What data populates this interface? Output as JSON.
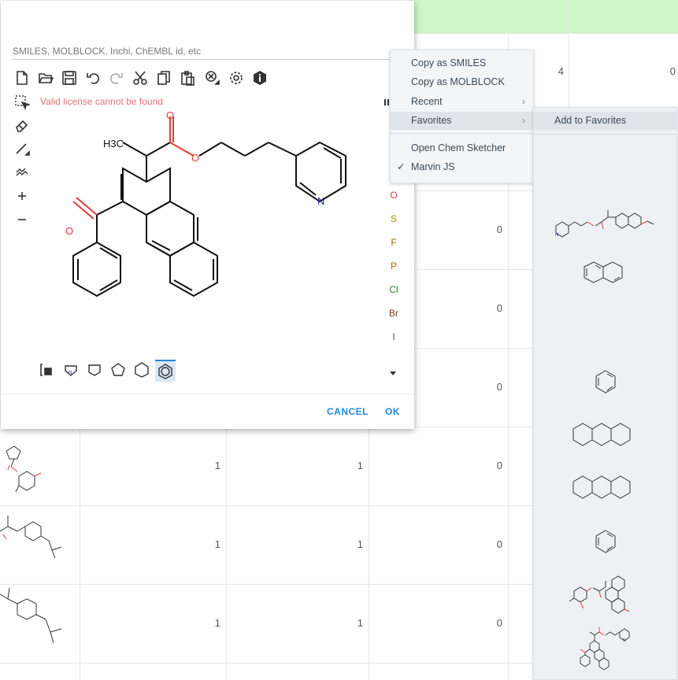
{
  "editor": {
    "input_placeholder": "SMILES, MOLBLOCK, Inchi, ChEMBL id, etc",
    "license_warning": "Valid license cannot be found",
    "molecule_labels": {
      "methyl": "H3C",
      "carbonyl_o": "O",
      "ester_o": "O",
      "ketone_o": "O",
      "nitrogen": "N"
    },
    "atoms": [
      "O",
      "S",
      "F",
      "P",
      "Cl",
      "Br",
      "I"
    ],
    "atom_colors": [
      "#e53935",
      "#a08b00",
      "#8d6e00",
      "#a07800",
      "#2e7d32",
      "#7b3f1e",
      "#7e3fa0"
    ],
    "cancel_label": "CANCEL",
    "ok_label": "OK"
  },
  "context_menu": {
    "items": [
      {
        "label": "Copy as SMILES",
        "submenu": false
      },
      {
        "label": "Copy as MOLBLOCK",
        "submenu": false
      },
      {
        "label": "Recent",
        "submenu": true
      },
      {
        "label": "Favorites",
        "submenu": true,
        "selected": true
      },
      {
        "label": "Open Chem Sketcher",
        "submenu": false
      },
      {
        "label": "Marvin JS",
        "submenu": false,
        "checked": true
      }
    ],
    "favorites_submenu": {
      "add_label": "Add to Favorites"
    }
  },
  "background_grid": {
    "header_color": "#cdf7c7",
    "rows": [
      {
        "c3": "",
        "c4": "",
        "c5": "4",
        "c6": "0"
      },
      {
        "c3": "",
        "c4": "",
        "c5": "0",
        "c6": ""
      },
      {
        "c3": "",
        "c4": "",
        "c5": "0",
        "c6": ""
      },
      {
        "c3": "",
        "c4": "",
        "c5": "0",
        "c6": ""
      },
      {
        "c3": "1",
        "c4": "1",
        "c5": "0",
        "c6": ""
      },
      {
        "c3": "1",
        "c4": "1",
        "c5": "0",
        "c6": ""
      },
      {
        "c3": "1",
        "c4": "1",
        "c5": "0",
        "c6": ""
      }
    ]
  }
}
